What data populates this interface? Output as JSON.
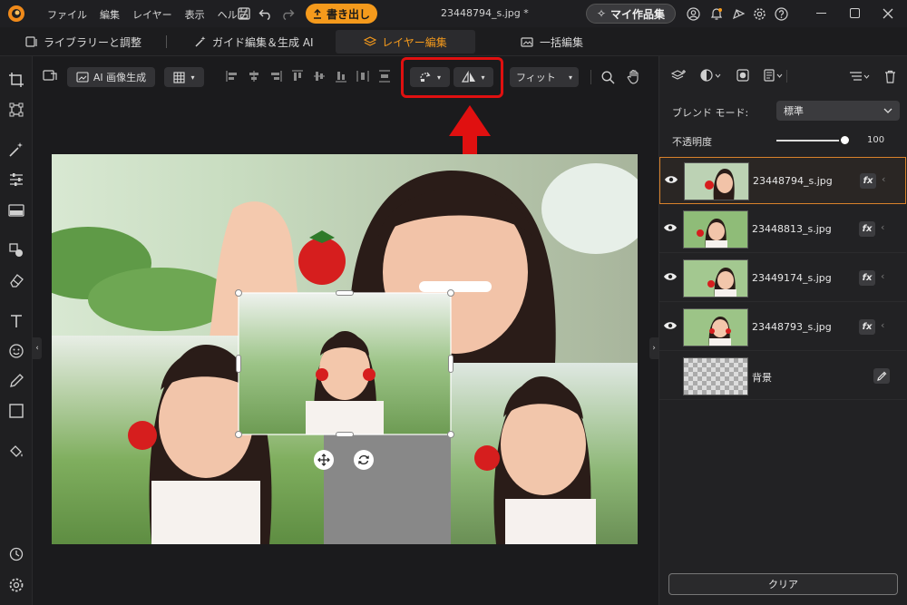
{
  "title_bar": {
    "menus": [
      "ファイル",
      "編集",
      "レイヤー",
      "表示",
      "ヘルプ"
    ],
    "export_label": "書き出し",
    "filename": "23448794_s.jpg *",
    "my_works_label": "マイ作品集"
  },
  "tabs": [
    {
      "label": "ライブラリーと調整"
    },
    {
      "label": "ガイド編集＆生成 AI"
    },
    {
      "label": "レイヤー編集"
    },
    {
      "label": "一括編集"
    }
  ],
  "toolbar": {
    "ai_generate_label": "AI 画像生成",
    "fit_label": "フィット"
  },
  "panel": {
    "blend_mode_label": "ブレンド モード:",
    "blend_mode_value": "標準",
    "opacity_label": "不透明度",
    "opacity_value": "100",
    "opacity_level": 1.0,
    "layers": [
      {
        "name": "23448794_s.jpg",
        "fx": "fx",
        "selected": true
      },
      {
        "name": "23448813_s.jpg",
        "fx": "fx",
        "selected": false
      },
      {
        "name": "23449174_s.jpg",
        "fx": "fx",
        "selected": false
      },
      {
        "name": "23448793_s.jpg",
        "fx": "fx",
        "selected": false
      },
      {
        "name": "背景",
        "fx": "",
        "selected": false
      }
    ],
    "clear_label": "クリア"
  },
  "colors": {
    "accent_orange": "#f59a1c",
    "highlight_red": "#e01010",
    "selection_border": "#d9822b"
  }
}
